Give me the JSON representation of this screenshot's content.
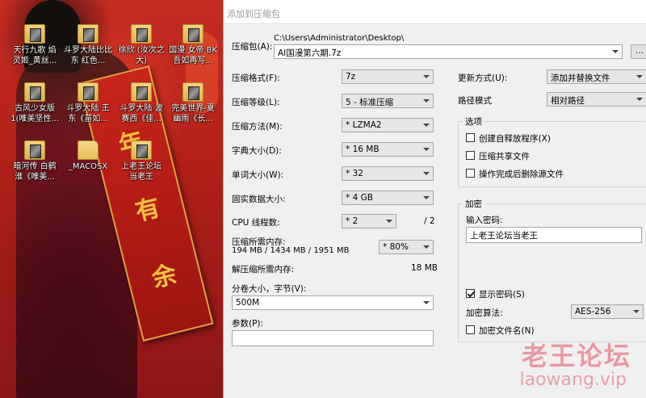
{
  "desktop": {
    "icons": [
      {
        "label": "天行九歌 焰灵姬_黄丝...",
        "icon": "video-file-icon"
      },
      {
        "label": "斗罗大陆比比东 红色...",
        "icon": "video-file-icon"
      },
      {
        "label": "徐欣 (汝次之大)",
        "icon": "video-file-icon"
      },
      {
        "label": "国漫 女帝 BK 吾如再写...",
        "icon": "video-file-icon"
      },
      {
        "label": "古风少女版 1(唯美坚性...",
        "icon": "video-file-icon"
      },
      {
        "label": "斗罗大陆 王东《苗如...",
        "icon": "video-file-icon"
      },
      {
        "label": "斗罗大陆 波赛西《佳...",
        "icon": "video-file-icon"
      },
      {
        "label": "完美世界-夏幽雨《长...",
        "icon": "video-file-icon"
      },
      {
        "label": "暗河传 白鹤淮《唯美...",
        "icon": "video-file-icon"
      },
      {
        "label": "_MACOSX",
        "icon": "folder-icon"
      },
      {
        "label": "上老王论坛 当老王",
        "icon": "archive-file-icon"
      }
    ],
    "couplet_chars": [
      "年",
      "有",
      "余"
    ]
  },
  "dialog": {
    "title": "添加到压缩包",
    "archive_label": "压缩包(A):",
    "archive_path": "C:\\Users\\Administrator\\Desktop\\",
    "archive_name": "AI国漫第六期.7z",
    "browse_button": "...",
    "format_label": "压缩格式(F):",
    "format_value": "7z",
    "level_label": "压缩等级(L):",
    "level_value": "5 - 标准压缩",
    "method_label": "压缩方法(M):",
    "method_value": "* LZMA2",
    "dict_label": "字典大小(D):",
    "dict_value": "* 16 MB",
    "word_label": "单词大小(W):",
    "word_value": "* 32",
    "solid_label": "固实数据大小:",
    "solid_value": "* 4 GB",
    "threads_label": "CPU 线程数:",
    "threads_value": "* 2",
    "threads_max": "/ 2",
    "mem_compress_label": "压缩所需内存:",
    "mem_compress_value": "194 MB / 1434 MB / 1951 MB",
    "mem_percent": "* 80%",
    "mem_decompress_label": "解压缩所需内存:",
    "mem_decompress_value": "18 MB",
    "split_label": "分卷大小，字节(V):",
    "split_value": "500M",
    "params_label": "参数(P):",
    "params_value": "",
    "update_label": "更新方式(U):",
    "update_value": "添加并替换文件",
    "pathmode_label": "路径模式",
    "pathmode_value": "相对路径",
    "options_title": "选项",
    "opt_sfx": "创建自释放程序(X)",
    "opt_shared": "压缩共享文件",
    "opt_delete": "操作完成后删除源文件",
    "encrypt_title": "加密",
    "password_label": "输入密码:",
    "password_value": "上老王论坛当老王",
    "show_password": "显示密码(S)",
    "show_password_checked": true,
    "enc_method_label": "加密算法:",
    "enc_method_value": "AES-256",
    "encrypt_names": "加密文件名(N)"
  },
  "watermark": {
    "cn": "老王论坛",
    "en": "laowang.vip"
  }
}
